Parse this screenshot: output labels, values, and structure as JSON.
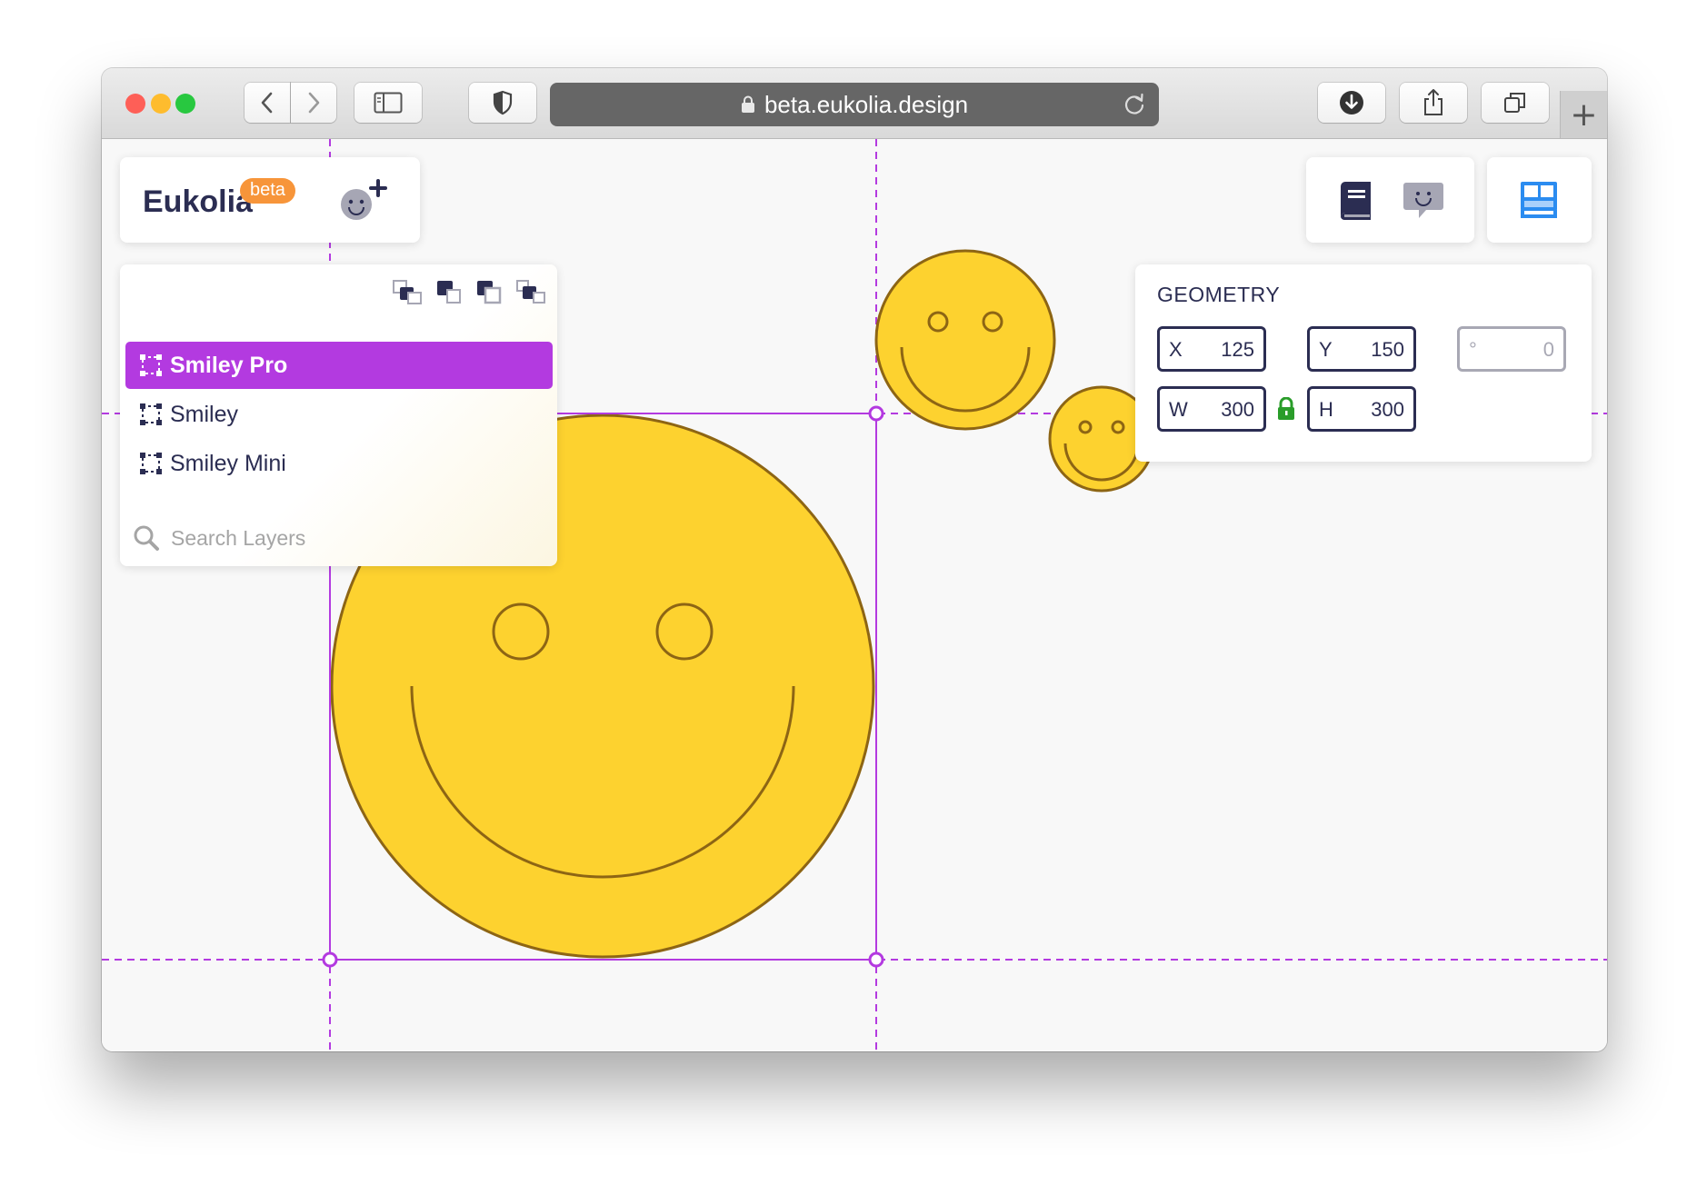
{
  "browser": {
    "url": "beta.eukolia.design",
    "traffic_lights": [
      "#fe5f57",
      "#febc2e",
      "#28c840"
    ],
    "new_tab_label": "+"
  },
  "header": {
    "brand": "Eukolia",
    "badge": "beta",
    "add_icon": "smiley-plus-icon",
    "right_icons": [
      "book-icon",
      "chat-smiley-icon",
      "layout-icon"
    ]
  },
  "layers": {
    "order_icons": [
      "send-backward-icon",
      "send-to-back-icon",
      "bring-forward-icon",
      "bring-to-front-icon"
    ],
    "items": [
      {
        "label": "Smiley Pro",
        "active": true
      },
      {
        "label": "Smiley",
        "active": false
      },
      {
        "label": "Smiley Mini",
        "active": false
      }
    ],
    "search_placeholder": "Search Layers"
  },
  "geometry": {
    "title": "GEOMETRY",
    "x": {
      "label": "X",
      "value": "125"
    },
    "y": {
      "label": "Y",
      "value": "150"
    },
    "rotation": {
      "label": "°",
      "value": "0"
    },
    "w": {
      "label": "W",
      "value": "300"
    },
    "h": {
      "label": "H",
      "value": "300"
    },
    "lock_color": "#2a9d2a"
  },
  "colors": {
    "accent": "#b33ae0",
    "smiley_fill": "#fdd22f",
    "smiley_stroke": "#8d6514",
    "ink": "#2b2d52"
  }
}
